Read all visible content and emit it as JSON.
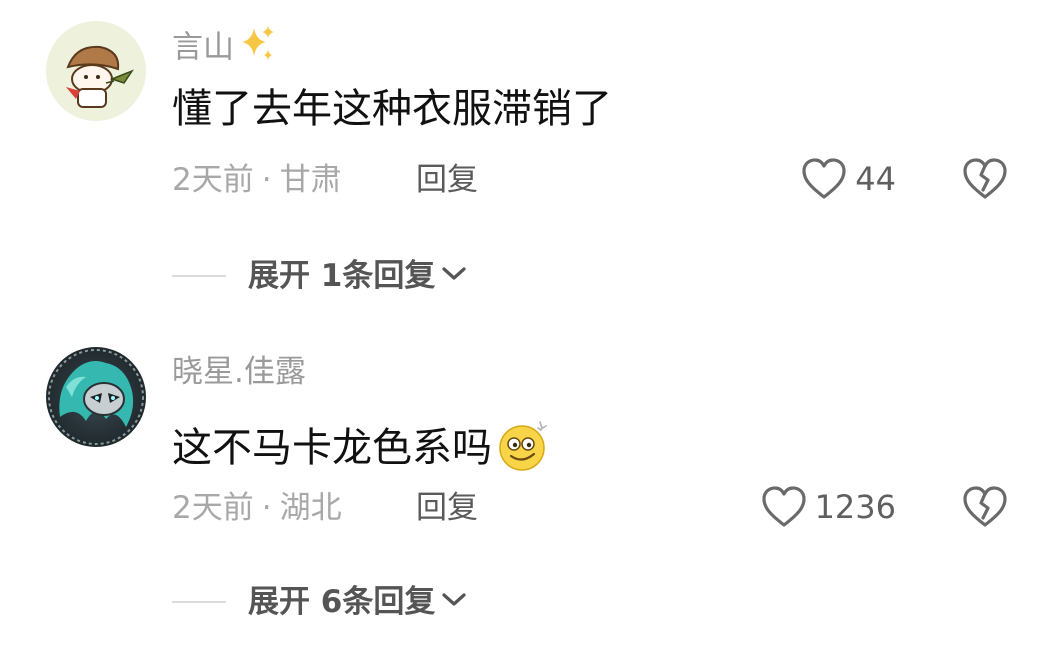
{
  "comments": [
    {
      "username": "言山",
      "username_decoration": "sparkles-icon",
      "content": "懂了去年这种衣服滞销了",
      "time": "2天前",
      "separator": "·",
      "location": "甘肃",
      "reply_label": "回复",
      "like_count": "44",
      "expand_label": "展开 1条回复",
      "avatar_icon": "mushroom-character-avatar"
    },
    {
      "username": "晓星.佳露",
      "content": "这不马卡龙色系吗",
      "content_emoji": "smiling-face-emoji",
      "time": "2天前",
      "separator": "·",
      "location": "湖北",
      "reply_label": "回复",
      "like_count": "1236",
      "expand_label": "展开 6条回复",
      "avatar_icon": "masked-hero-avatar"
    }
  ],
  "colors": {
    "username": "#9a9a9a",
    "content": "#111111",
    "meta": "#a8a8a8",
    "reply": "#5a5a5a",
    "icon": "#6a6a6a",
    "divider": "#dcdcdc"
  }
}
